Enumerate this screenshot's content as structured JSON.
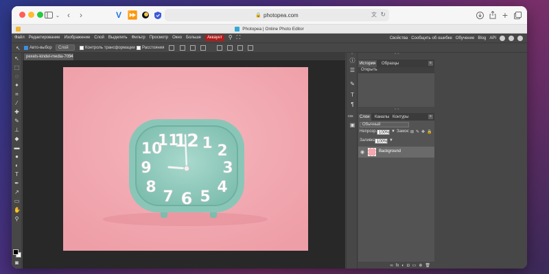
{
  "browser": {
    "url": "photopea.com",
    "tab_title": "Photopea | Online Photo Editor",
    "icons": [
      "sidebar-icon",
      "back-icon",
      "forward-icon",
      "extension-icons",
      "download-icon",
      "share-icon",
      "new-tab-icon",
      "tabs-overview-icon"
    ]
  },
  "menu": {
    "items": [
      "Файл",
      "Редактирование",
      "Изображение",
      "Слой",
      "Выделить",
      "Фильтр",
      "Просмотр",
      "Окно",
      "Больше"
    ],
    "account": "Аккаунт",
    "right": [
      "Свойства",
      "Сообщить об ошибке",
      "Обучение",
      "Blog",
      "API"
    ]
  },
  "options": {
    "auto_select": "Авто-выбор",
    "layer_select": "Слой",
    "transform_controls": "Контроль трансформации",
    "distances": "Расстояния"
  },
  "document": {
    "tab": "pexels-kindel-media-7054"
  },
  "history_panel": {
    "tabs": [
      "История",
      "Образцы"
    ],
    "entries": [
      "Открыть"
    ]
  },
  "layers_panel": {
    "tabs": [
      "Слои",
      "Каналы",
      "Контуры"
    ],
    "blend_mode": "Обычный",
    "opacity_label": "Непрозр.",
    "opacity_value": "100%",
    "lock_label": "Замок:",
    "fill_label": "Заливка:",
    "fill_value": "100%",
    "layers": [
      {
        "name": "Background"
      }
    ]
  },
  "strip_label": "css",
  "clock_numbers": [
    "12",
    "1",
    "2",
    "3",
    "4",
    "5",
    "6",
    "7",
    "8",
    "9",
    "10",
    "11"
  ],
  "colors": {
    "accent_account": "#b31b1b",
    "ui_bg": "#474747",
    "canvas_bg": "#282828",
    "photo_pink": "#f3aab3",
    "clock_teal": "#8fc9bb"
  }
}
